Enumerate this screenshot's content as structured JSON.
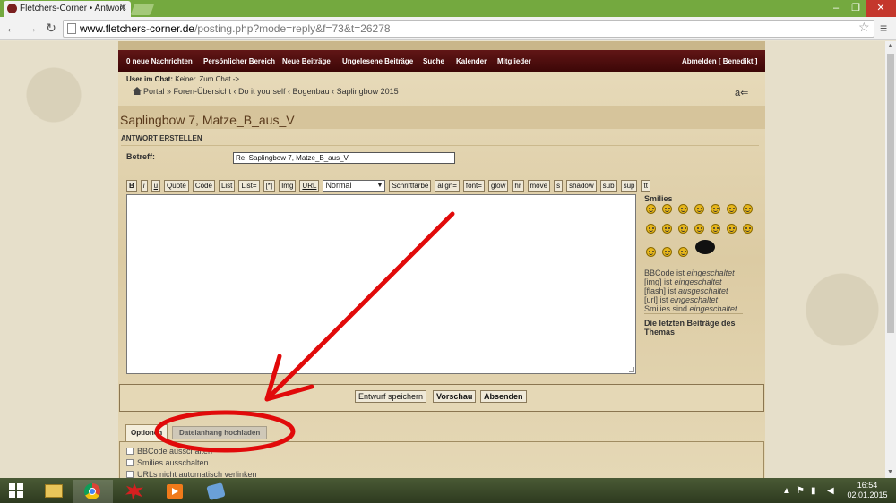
{
  "browser": {
    "tab_title": "Fletchers-Corner • Antwort",
    "url_host": "www.fletchers-corner.de",
    "url_path": "/posting.php?mode=reply&f=73&t=26278"
  },
  "forum": {
    "nav": {
      "new_messages": "0 neue Nachrichten",
      "personal": "Persönlicher Bereich",
      "new_posts": "Neue Beiträge",
      "unread": "Ungelesene Beiträge",
      "search": "Suche",
      "calendar": "Kalender",
      "members": "Mitglieder",
      "logout": "Abmelden [ Benedikt ]"
    },
    "chat_label": "User im Chat:",
    "chat_text": "Keiner. Zum Chat ->",
    "breadcrumb": "Portal » Foren-Übersicht ‹ Do it yourself ‹ Bogenbau ‹ Saplingbow 2015",
    "topic_title": "Saplingbow 7, Matze_B_aus_V",
    "section_heading": "ANTWORT ERSTELLEN",
    "subject_label": "Betreff:",
    "subject_value": "Re: Saplingbow 7, Matze_B_aus_V",
    "bbcode_buttons_a": [
      "B",
      "i",
      "u",
      "Quote",
      "Code",
      "List",
      "List=",
      "[*]",
      "Img",
      "URL"
    ],
    "font_size_select": "Normal",
    "bbcode_buttons_b": [
      "Schriftfarbe",
      "align=",
      "font=",
      "glow",
      "hr",
      "move",
      "s",
      "shadow",
      "sub",
      "sup",
      "tt"
    ],
    "smilies_title": "Smilies",
    "bbcode_status": [
      {
        "prefix": "BBCode ist ",
        "value": "eingeschaltet"
      },
      {
        "prefix": "[img] ist ",
        "value": "eingeschaltet"
      },
      {
        "prefix": "[flash] ist ",
        "value": "ausgeschaltet"
      },
      {
        "prefix": "[url] ist ",
        "value": "eingeschaltet"
      },
      {
        "prefix": "Smilies sind ",
        "value": "eingeschaltet"
      }
    ],
    "recent_posts_title": "Die letzten Beiträge des Themas",
    "buttons": {
      "save_draft": "Entwurf speichern",
      "preview": "Vorschau",
      "submit": "Absenden"
    },
    "tabs": {
      "options": "Optionen",
      "attachment": "Dateianhang hochladen"
    },
    "options": [
      "BBCode ausschalten",
      "Smilies ausschalten",
      "URLs nicht automatisch verlinken"
    ]
  },
  "annotation": {
    "color": "#e10a0a"
  },
  "taskbar": {
    "time": "16:54",
    "date": "02.01.2015"
  }
}
